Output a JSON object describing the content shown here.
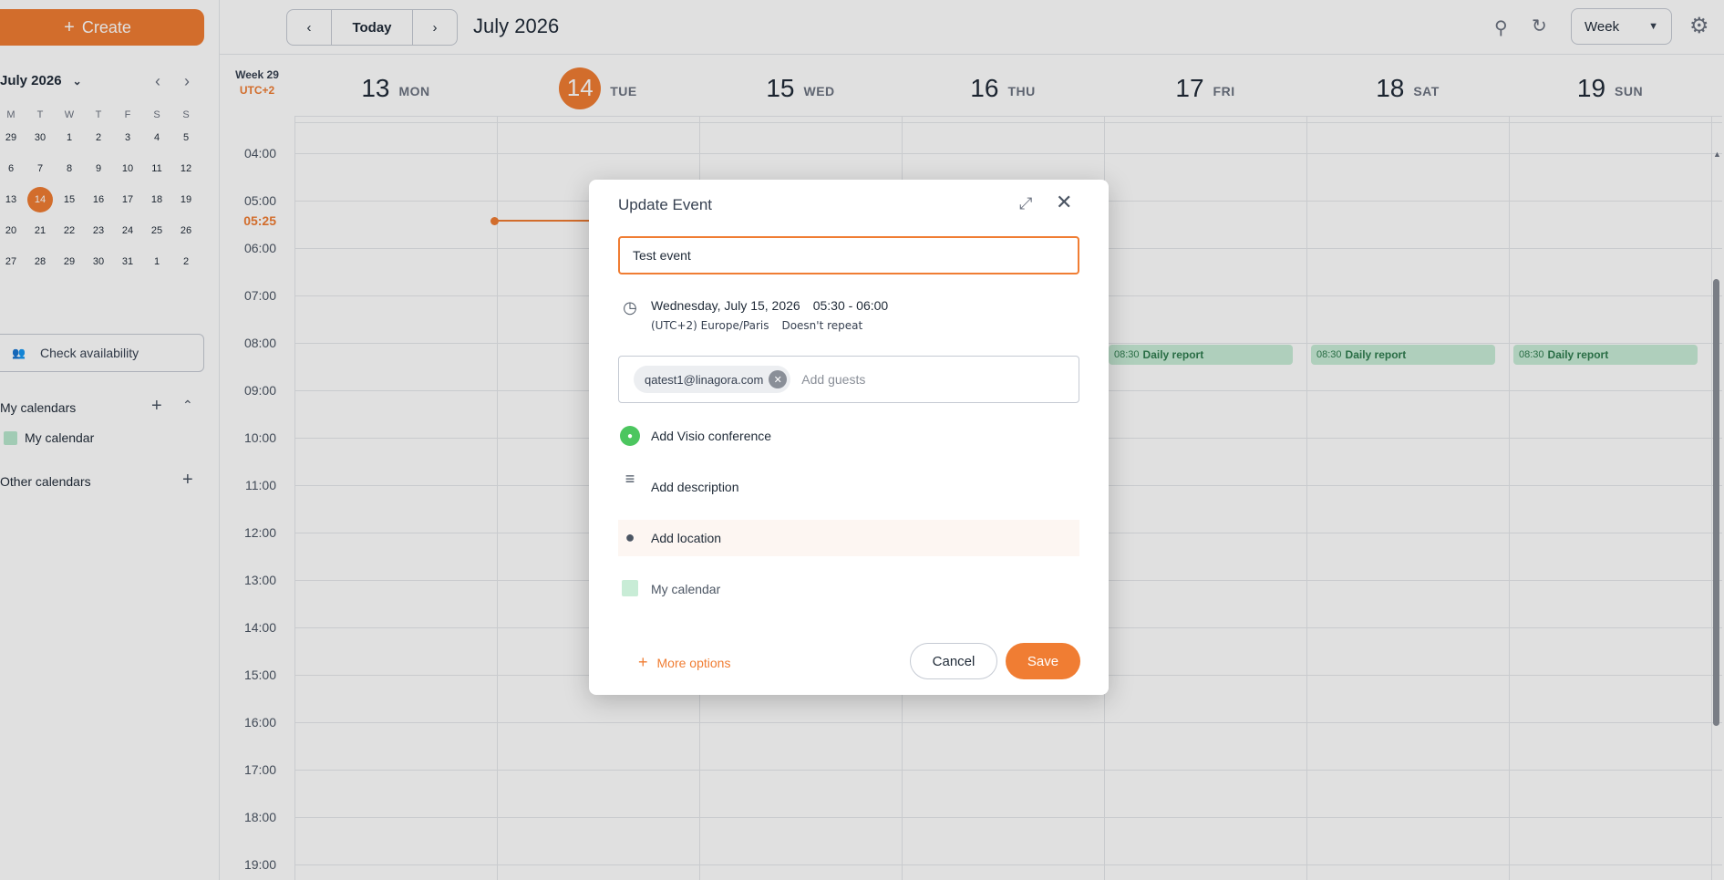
{
  "sidebar": {
    "create_label": "Create",
    "mini_calendar": {
      "title": "July 2026",
      "dow": [
        "M",
        "T",
        "W",
        "T",
        "F",
        "S",
        "S"
      ],
      "weeks": [
        [
          "29",
          "30",
          "1",
          "2",
          "3",
          "4",
          "5"
        ],
        [
          "6",
          "7",
          "8",
          "9",
          "10",
          "11",
          "12"
        ],
        [
          "13",
          "14",
          "15",
          "16",
          "17",
          "18",
          "19"
        ],
        [
          "20",
          "21",
          "22",
          "23",
          "24",
          "25",
          "26"
        ],
        [
          "27",
          "28",
          "29",
          "30",
          "31",
          "1",
          "2"
        ]
      ],
      "today": "14"
    },
    "check_availability": "Check availability",
    "my_calendars_label": "My calendars",
    "my_calendar_item": "My calendar",
    "other_calendars_label": "Other calendars"
  },
  "header": {
    "today_label": "Today",
    "period_title": "July 2026",
    "view_select": "Week"
  },
  "week": {
    "week_label": "Week 29",
    "timezone": "UTC+2",
    "days": [
      {
        "num": "13",
        "name": "MON",
        "today": false
      },
      {
        "num": "14",
        "name": "TUE",
        "today": true
      },
      {
        "num": "15",
        "name": "WED",
        "today": false
      },
      {
        "num": "16",
        "name": "THU",
        "today": false
      },
      {
        "num": "17",
        "name": "FRI",
        "today": false
      },
      {
        "num": "18",
        "name": "SAT",
        "today": false
      },
      {
        "num": "19",
        "name": "SUN",
        "today": false
      }
    ],
    "hours": [
      "04:00",
      "05:00",
      "06:00",
      "07:00",
      "08:00",
      "09:00",
      "10:00",
      "11:00",
      "12:00",
      "13:00",
      "14:00",
      "15:00",
      "16:00",
      "17:00",
      "18:00",
      "19:00"
    ],
    "now_time": "05:25",
    "events": [
      {
        "day": 4,
        "time": "08:30",
        "name": "Daily report"
      },
      {
        "day": 5,
        "time": "08:30",
        "name": "Daily report"
      },
      {
        "day": 6,
        "time": "08:30",
        "name": "Daily report"
      }
    ]
  },
  "dialog": {
    "title": "Update Event",
    "event_title_value": "Test event",
    "date": "Wednesday, July 15, 2026",
    "time_range": "05:30 - 06:00",
    "timezone": "(UTC+2) Europe/Paris",
    "repeat": "Doesn't repeat",
    "guest_email": "qatest1@linagora.com",
    "guests_placeholder": "Add guests",
    "visio_label": "Add Visio conference",
    "description_label": "Add description",
    "location_label": "Add location",
    "calendar_label": "My calendar",
    "more_options": "More options",
    "cancel": "Cancel",
    "save": "Save"
  },
  "colors": {
    "accent": "#f07d33",
    "event_bg": "#c8ecd6",
    "event_text": "#2f7d4f"
  }
}
